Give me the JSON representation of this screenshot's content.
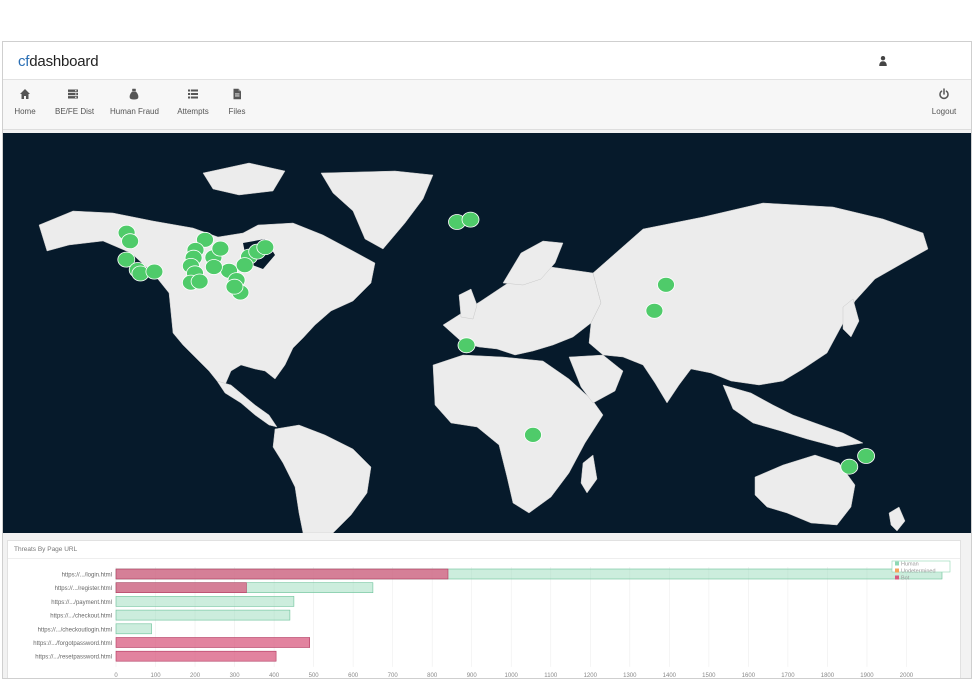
{
  "app": {
    "brand_prefix": "cf",
    "brand_suffix": "dashboard"
  },
  "header": {
    "user_icon": "user-icon"
  },
  "nav": {
    "items": [
      {
        "label": "Home",
        "icon": "home-icon"
      },
      {
        "label": "BE/FE Dist",
        "icon": "server-icon"
      },
      {
        "label": "Human Fraud",
        "icon": "money-bag-icon"
      },
      {
        "label": "Attempts",
        "icon": "list-icon"
      },
      {
        "label": "Files",
        "icon": "file-icon"
      }
    ],
    "logout": {
      "label": "Logout",
      "icon": "power-icon"
    }
  },
  "map": {
    "ocean_color": "#061a2b",
    "land_color": "#ececec",
    "marker_color": "#4fcb6a",
    "markers": [
      {
        "lon": -122.3,
        "lat": 47.6
      },
      {
        "lon": -121.0,
        "lat": 44.5
      },
      {
        "lon": -122.4,
        "lat": 37.8
      },
      {
        "lon": -118.2,
        "lat": 34.0
      },
      {
        "lon": -117.2,
        "lat": 32.7
      },
      {
        "lon": -112.0,
        "lat": 33.4
      },
      {
        "lon": -93.3,
        "lat": 45.0
      },
      {
        "lon": -96.8,
        "lat": 41.3
      },
      {
        "lon": -97.5,
        "lat": 38.5
      },
      {
        "lon": -98.5,
        "lat": 35.5
      },
      {
        "lon": -97.0,
        "lat": 32.8
      },
      {
        "lon": -98.5,
        "lat": 29.4
      },
      {
        "lon": -95.3,
        "lat": 29.8
      },
      {
        "lon": -90.2,
        "lat": 38.6
      },
      {
        "lon": -87.6,
        "lat": 41.8
      },
      {
        "lon": -84.4,
        "lat": 33.7
      },
      {
        "lon": -90.0,
        "lat": 35.1
      },
      {
        "lon": -81.6,
        "lat": 30.3
      },
      {
        "lon": -80.2,
        "lat": 25.8
      },
      {
        "lon": -82.4,
        "lat": 27.9
      },
      {
        "lon": -77.0,
        "lat": 38.9
      },
      {
        "lon": -74.0,
        "lat": 40.7
      },
      {
        "lon": -71.0,
        "lat": 42.3
      },
      {
        "lon": -78.6,
        "lat": 35.8
      },
      {
        "lon": -0.1,
        "lat": 51.5
      },
      {
        "lon": 4.9,
        "lat": 52.4
      },
      {
        "lon": 77.2,
        "lat": 28.6
      },
      {
        "lon": 72.9,
        "lat": 19.1
      },
      {
        "lon": 3.4,
        "lat": 6.5
      },
      {
        "lon": 28.0,
        "lat": -26.2
      },
      {
        "lon": 151.2,
        "lat": -33.9
      },
      {
        "lon": 145.0,
        "lat": -37.8
      }
    ]
  },
  "panel": {
    "title": "Threats By Page URL"
  },
  "chart_data": {
    "type": "bar",
    "orientation": "horizontal",
    "stacked": false,
    "title": "Threats By Page URL",
    "categories": [
      "https://.../login.html",
      "https://.../register.html",
      "https://.../payment.html",
      "https://.../checkout.html",
      "https://.../checkoutlogin.html",
      "https://.../forgotpassword.html",
      "https://.../resetpassword.html"
    ],
    "series": [
      {
        "name": "Human",
        "color": "#8fd8b4",
        "values": [
          2090,
          650,
          450,
          440,
          90,
          0,
          0
        ]
      },
      {
        "name": "Undetermined",
        "color": "#f4a35c",
        "values": [
          0,
          0,
          0,
          0,
          0,
          0,
          0
        ]
      },
      {
        "name": "Bot",
        "color": "#d85a7f",
        "values": [
          840,
          330,
          0,
          0,
          0,
          490,
          405
        ]
      }
    ],
    "xlim": [
      0,
      2100
    ],
    "xticks": [
      "0",
      "100",
      "200",
      "300",
      "400",
      "500",
      "600",
      "700",
      "800",
      "900",
      "1000",
      "1100",
      "1200",
      "1300",
      "1400",
      "1500",
      "1600",
      "1700",
      "1800",
      "1900",
      "2000"
    ],
    "legend": "top-right",
    "grid": true
  }
}
